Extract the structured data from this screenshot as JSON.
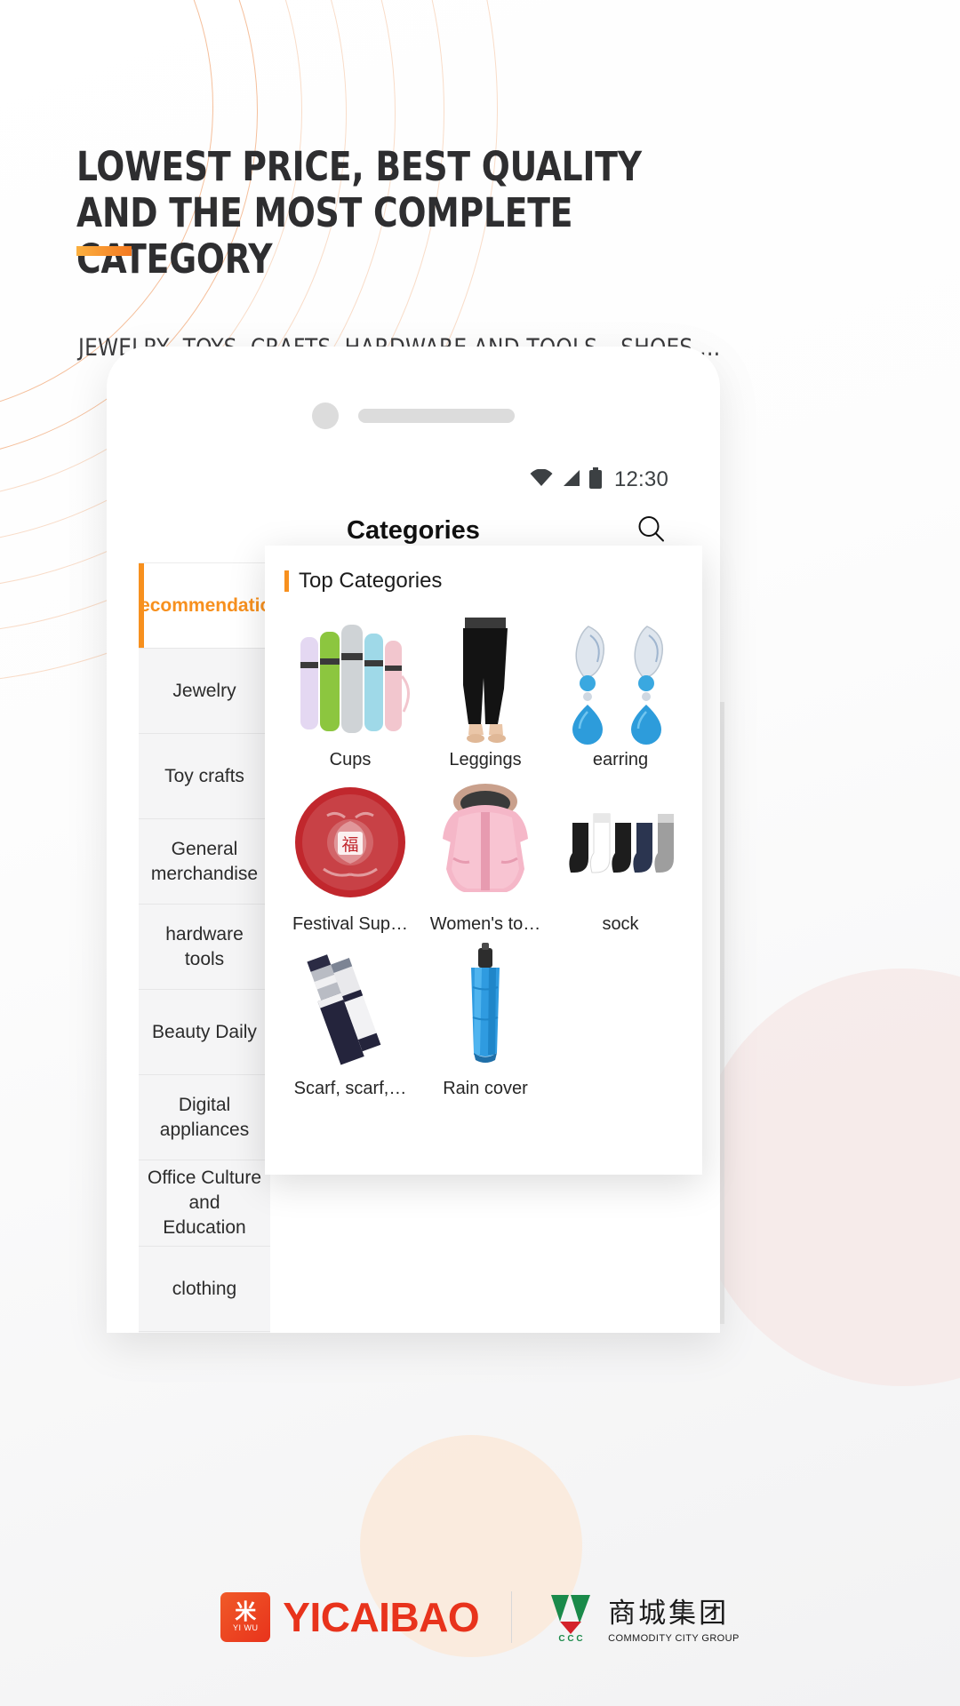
{
  "banner": {
    "headline": "LOWEST PRICE, BEST QUALITY AND THE MOST COMPLETE CATEGORY",
    "subtitle": "JEWELRY, TOYS, CRAFTS, HARDWARE AND TOOLS，SHOES …",
    "accent_color": "#f7901e",
    "accent_gradient_from": "#fbb040",
    "accent_gradient_to": "#f47920"
  },
  "phone": {
    "status_bar": {
      "time": "12:30",
      "icons": [
        "wifi-icon",
        "signal-icon",
        "battery-icon"
      ]
    },
    "header": {
      "title": "Categories",
      "search_icon": "search-icon"
    },
    "sidebar": {
      "items": [
        {
          "label": "Recommendation",
          "active": true
        },
        {
          "label": "Jewelry",
          "active": false
        },
        {
          "label": "Toy crafts",
          "active": false
        },
        {
          "label": "General merchandise",
          "active": false
        },
        {
          "label": "hardware tools",
          "active": false
        },
        {
          "label": "Beauty Daily",
          "active": false
        },
        {
          "label": "Digital appliances",
          "active": false
        },
        {
          "label": "Office Culture and Education",
          "active": false
        },
        {
          "label": "clothing",
          "active": false
        }
      ]
    },
    "categories_panel": {
      "title": "Top Categories",
      "items": [
        {
          "label": "Cups",
          "icon": "cups-thumbnail"
        },
        {
          "label": "Leggings",
          "icon": "leggings-thumbnail"
        },
        {
          "label": "earring",
          "icon": "earring-thumbnail"
        },
        {
          "label": "Festival Sup…",
          "icon": "festival-supplies-thumbnail"
        },
        {
          "label": "Women's to…",
          "icon": "womens-top-thumbnail"
        },
        {
          "label": "sock",
          "icon": "sock-thumbnail"
        },
        {
          "label": "Scarf, scarf,…",
          "icon": "scarf-thumbnail"
        },
        {
          "label": "Rain cover",
          "icon": "rain-cover-thumbnail"
        }
      ]
    }
  },
  "footer": {
    "yicaibao": {
      "mark_cn": "米",
      "mark_en": "YI WU",
      "wordmark": "YICAIBAO"
    },
    "commodity_city": {
      "mark": "ccg-logo-icon",
      "name_cn": "商城集团",
      "name_en": "COMMODITY CITY GROUP",
      "mark_letters": "C C C"
    }
  }
}
